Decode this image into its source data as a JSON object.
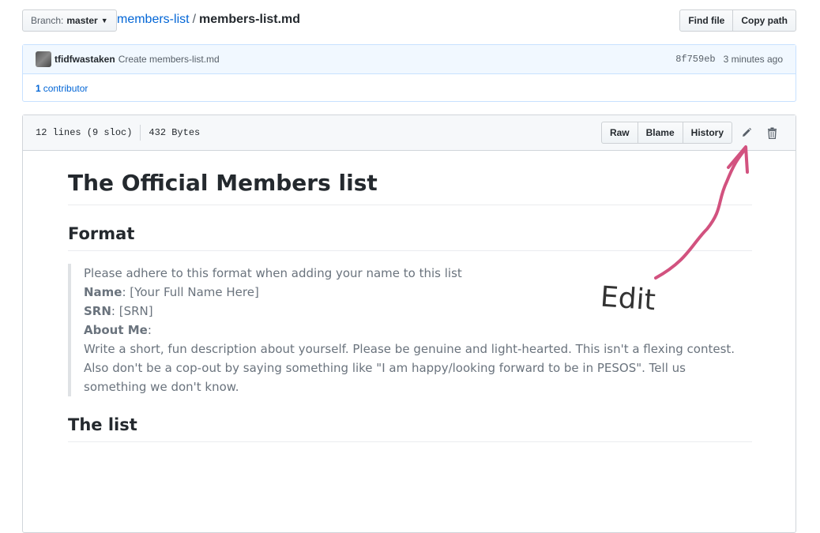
{
  "header": {
    "branch_label": "Branch:",
    "branch_value": "master",
    "repo": "members-list",
    "separator": "/",
    "file": "members-list.md",
    "find_file": "Find file",
    "copy_path": "Copy path"
  },
  "commit": {
    "author": "tfidfwastaken",
    "message": "Create members-list.md",
    "sha": "8f759eb",
    "time": "3 minutes ago",
    "contributors_count": "1",
    "contributors_label": "contributor"
  },
  "file_header": {
    "lines": "12 lines (9 sloc)",
    "size": "432 Bytes",
    "raw": "Raw",
    "blame": "Blame",
    "history": "History"
  },
  "markdown": {
    "title": "The Official Members list",
    "format_heading": "Format",
    "quote_intro": "Please adhere to this format when adding your name to this list",
    "name_label": "Name",
    "name_value": ": [Your Full Name Here]",
    "srn_label": "SRN",
    "srn_value": ": [SRN]",
    "about_label": "About Me",
    "about_suffix": ":",
    "about_line1": "Write a short, fun description about yourself. Please be genuine and light-hearted. This isn't a flexing contest.",
    "about_line2": "Also don't be a cop-out by saying something like \"I am happy/looking forward to be in PESOS\". Tell us something we don't know.",
    "list_heading": "The list"
  },
  "annotation": {
    "text": "Edit",
    "color": "#d2527f"
  },
  "icons": {
    "edit": "pencil-icon",
    "delete": "trash-icon",
    "dropdown": "caret-down-icon"
  }
}
